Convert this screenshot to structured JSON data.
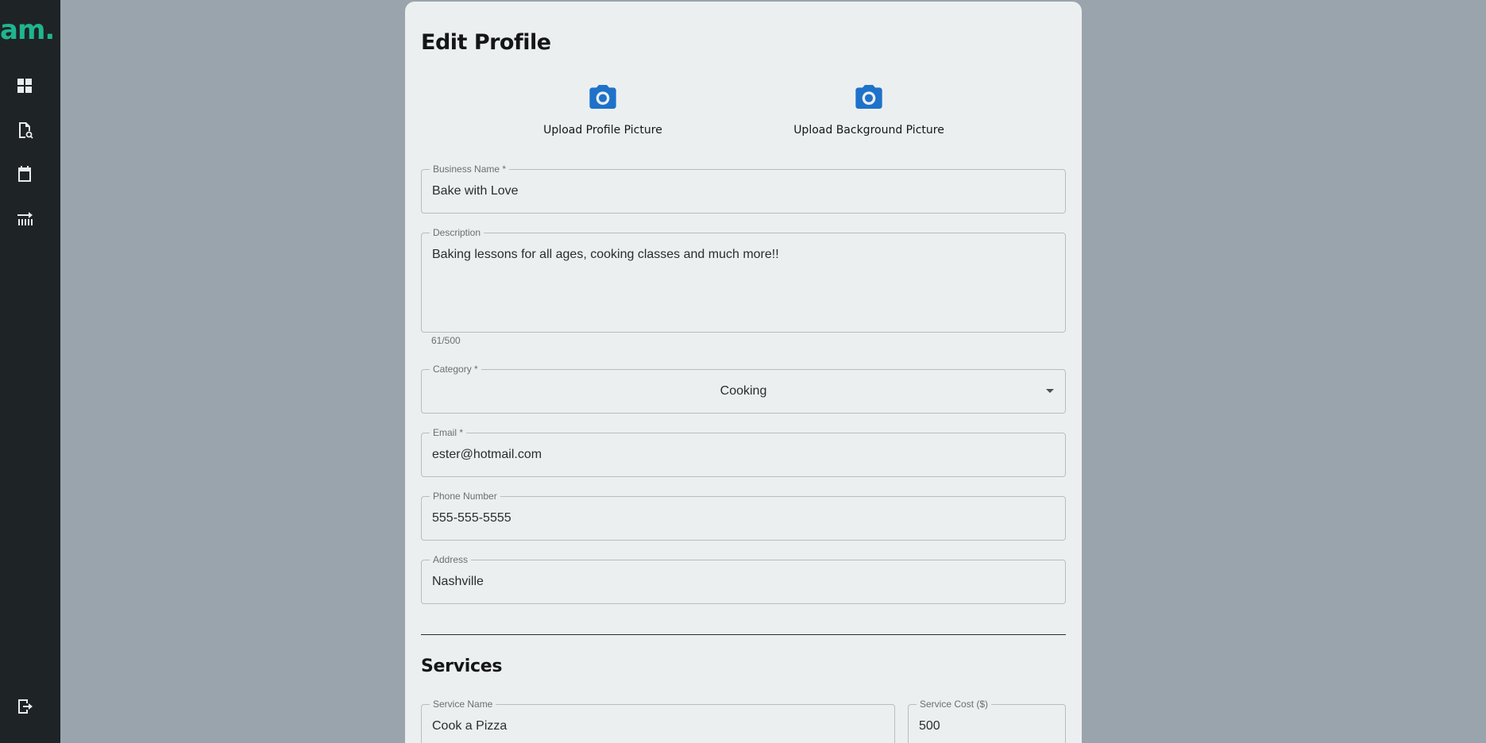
{
  "sidebar": {
    "logo_text": "am.",
    "icons": [
      "dashboard-icon",
      "document-search-icon",
      "calendar-icon",
      "timeline-icon",
      "logout-icon"
    ]
  },
  "page": {
    "title": "Edit Profile",
    "upload_profile_label": "Upload Profile Picture",
    "upload_background_label": "Upload Background Picture"
  },
  "form": {
    "business_name": {
      "label": "Business Name *",
      "value": "Bake with Love"
    },
    "description": {
      "label": "Description",
      "value": "Baking lessons for all ages, cooking classes and much more!!",
      "counter": "61/500"
    },
    "category": {
      "label": "Category *",
      "value": "Cooking"
    },
    "email": {
      "label": "Email *",
      "value": "ester@hotmail.com"
    },
    "phone": {
      "label": "Phone Number",
      "value": "555-555-5555"
    },
    "address": {
      "label": "Address",
      "value": "Nashville"
    }
  },
  "services": {
    "title": "Services",
    "service_name": {
      "label": "Service Name",
      "value": "Cook a Pizza"
    },
    "service_cost": {
      "label": "Service Cost ($)",
      "value": "500"
    }
  },
  "colors": {
    "accent": "#1e72c9",
    "brand": "#1fb58f",
    "sidebar": "#1e2326",
    "background": "#9aa4ad",
    "card": "#eceff0"
  }
}
